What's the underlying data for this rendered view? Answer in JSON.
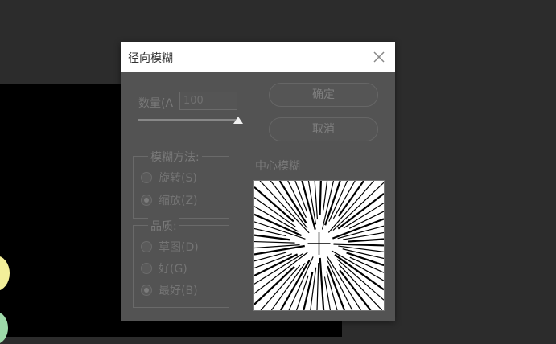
{
  "dialog": {
    "title": "径向模糊",
    "close_icon": "close-icon",
    "amount": {
      "label": "数量(A",
      "value": "100"
    },
    "slider": {
      "value": 100,
      "min": 0,
      "max": 100
    },
    "buttons": {
      "ok": "确定",
      "cancel": "取消"
    },
    "blur_method": {
      "legend": "模糊方法:",
      "options": [
        {
          "label": "旋转(S)",
          "selected": false
        },
        {
          "label": "缩放(Z)",
          "selected": true
        }
      ]
    },
    "quality": {
      "legend": "品质:",
      "options": [
        {
          "label": "草图(D)",
          "selected": false
        },
        {
          "label": "好(G)",
          "selected": false
        },
        {
          "label": "最好(B)",
          "selected": true
        }
      ]
    },
    "center": {
      "label": "中心模糊"
    }
  },
  "colors": {
    "workspace": "#2c2c2c",
    "dialog_bg": "#535353",
    "canvas": "#000000",
    "swatch_yellow": "#f3ef9a",
    "swatch_green": "#9ed9a9"
  }
}
